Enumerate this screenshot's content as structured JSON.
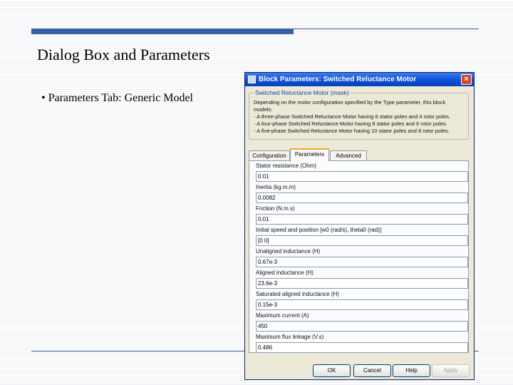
{
  "slide": {
    "title": "Dialog Box and Parameters",
    "bullet": "• Parameters Tab: Generic Model"
  },
  "dialog": {
    "title": "Block Parameters: Switched Reluctance Motor",
    "close_glyph": "×",
    "group_title": "Switched Reluctance Motor (mask)",
    "description": [
      "Depending on the motor configuration specified by the Type parameter, this block",
      "models:",
      "- A three-phase Switched Reluctance Motor having 6 stator poles and 4 rotor poles.",
      "- A four-phase Switched Reluctance Motor having 8 stator poles and 6 rotor poles.",
      "- A five-phase Switched Reluctance Motor having 10 stator poles and 8 rotor poles."
    ],
    "tabs": [
      "Configuration",
      "Parameters",
      "Advanced"
    ],
    "active_tab": "Parameters",
    "params": [
      {
        "label": "Stator resistance (Ohm)",
        "value": "0.01"
      },
      {
        "label": "Inertia (kg.m.m)",
        "value": "0.0082"
      },
      {
        "label": "Friction (N.m.s)",
        "value": "0.01"
      },
      {
        "label": "Initial speed and position [w0 (rad/s), theta0 (rad)]",
        "value": "[0 0]"
      },
      {
        "label": "Unaligned inductance (H)",
        "value": "0.67e-3"
      },
      {
        "label": "Aligned inductance (H)",
        "value": "23.6e-3"
      },
      {
        "label": "Saturated aligned inductance (H)",
        "value": "0.15e-3"
      },
      {
        "label": "Maximum current (A)",
        "value": "450"
      },
      {
        "label": "Maximum flux linkage (V.s)",
        "value": "0.486"
      }
    ],
    "buttons": {
      "ok": "OK",
      "cancel": "Cancel",
      "help": "Help",
      "apply": "Apply"
    }
  },
  "colors": {
    "accent": "#3a5fa6",
    "titlebar": "#0b4fd8",
    "dialog_bg": "#ece9d8"
  }
}
